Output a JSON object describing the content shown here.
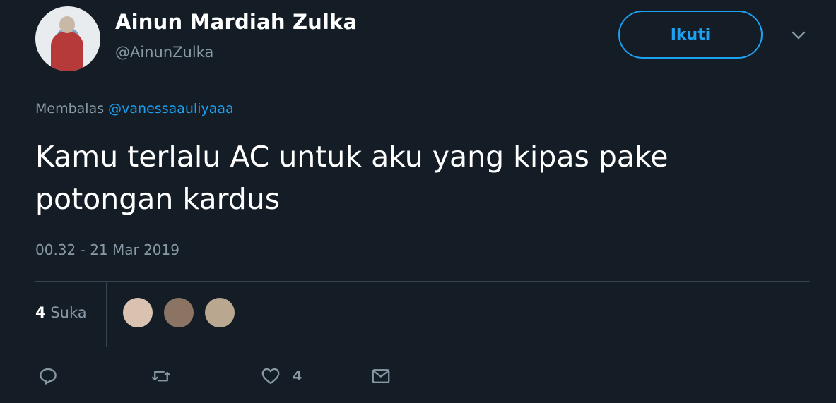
{
  "author": {
    "display_name": "Ainun Mardiah Zulka",
    "handle": "@AinunZulka"
  },
  "follow_button_label": "Ikuti",
  "reply_context": {
    "prefix": "Membalas",
    "mention": "@vanessaauliyaaa"
  },
  "tweet_text": "Kamu terlalu AC untuk aku yang kipas pake potongan kardus",
  "timestamp": "00.32 - 21 Mar 2019",
  "engagement": {
    "likes_count": "4",
    "likes_label": "Suka"
  },
  "actions": {
    "like_count": "4"
  },
  "icons": [
    "chevron-down-icon",
    "reply-icon",
    "retweet-icon",
    "heart-icon",
    "envelope-icon"
  ],
  "colors": {
    "background": "#141d26",
    "accent": "#1da1f2",
    "muted_text": "#8899a6",
    "divider": "#38444d"
  }
}
